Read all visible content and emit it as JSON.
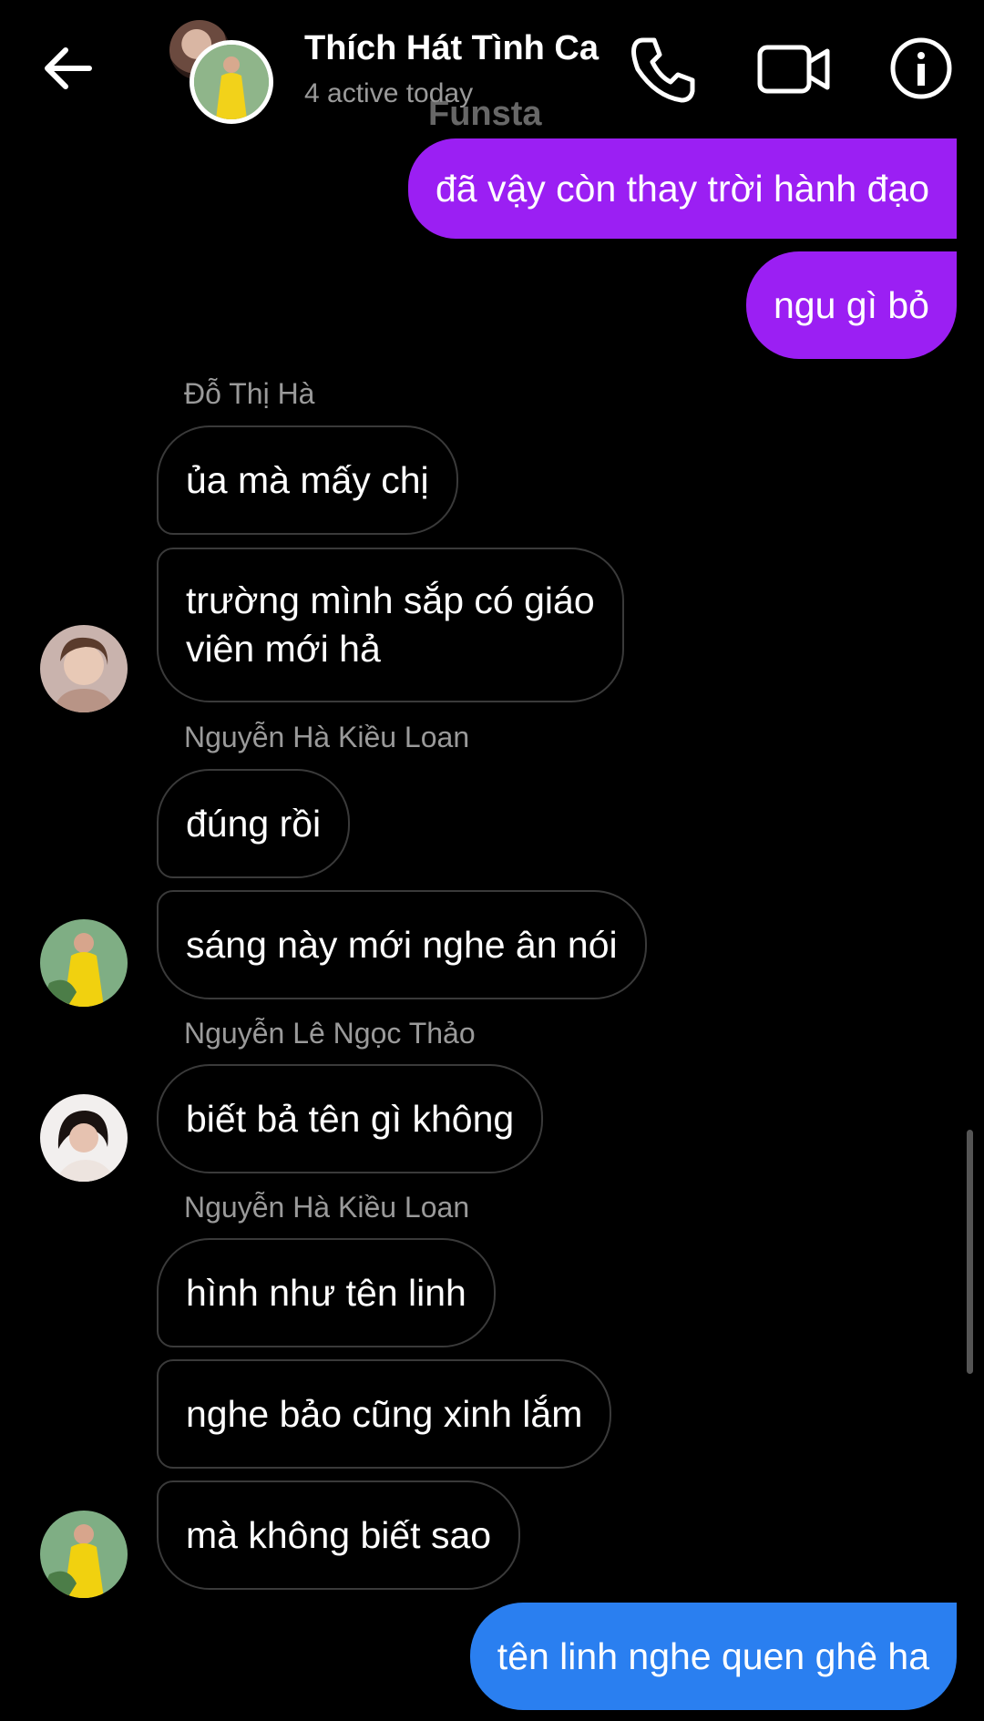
{
  "header": {
    "title": "Thích Hát Tình Ca",
    "subtitle": "4 active today",
    "watermark": "Funsta"
  },
  "messages": {
    "m1": "đã vậy còn thay trời hành đạo",
    "m2": "ngu gì bỏ",
    "n1": "Đỗ Thị Hà",
    "m3": "ủa mà mấy chị",
    "m4a": "trường mình sắp có giáo",
    "m4b": "viên mới hả",
    "n2": "Nguyễn Hà Kiều Loan",
    "m5": "đúng rồi",
    "m6": "sáng này mới nghe ân nói",
    "n3": "Nguyễn Lê Ngọc Thảo",
    "m7": "biết bả tên gì không",
    "n4": "Nguyễn Hà Kiều Loan",
    "m8": "hình như tên linh",
    "m9": "nghe bảo cũng xinh lắm",
    "m10": "mà không biết sao",
    "m11": "tên linh nghe quen ghê ha"
  },
  "colors": {
    "outgoing_purple": "#9b1ff3",
    "outgoing_blue": "#2a7ff0",
    "incoming_border": "#3a3a3a",
    "background": "#000000"
  },
  "icons": [
    "back-arrow-icon",
    "phone-icon",
    "video-camera-icon",
    "info-icon"
  ]
}
